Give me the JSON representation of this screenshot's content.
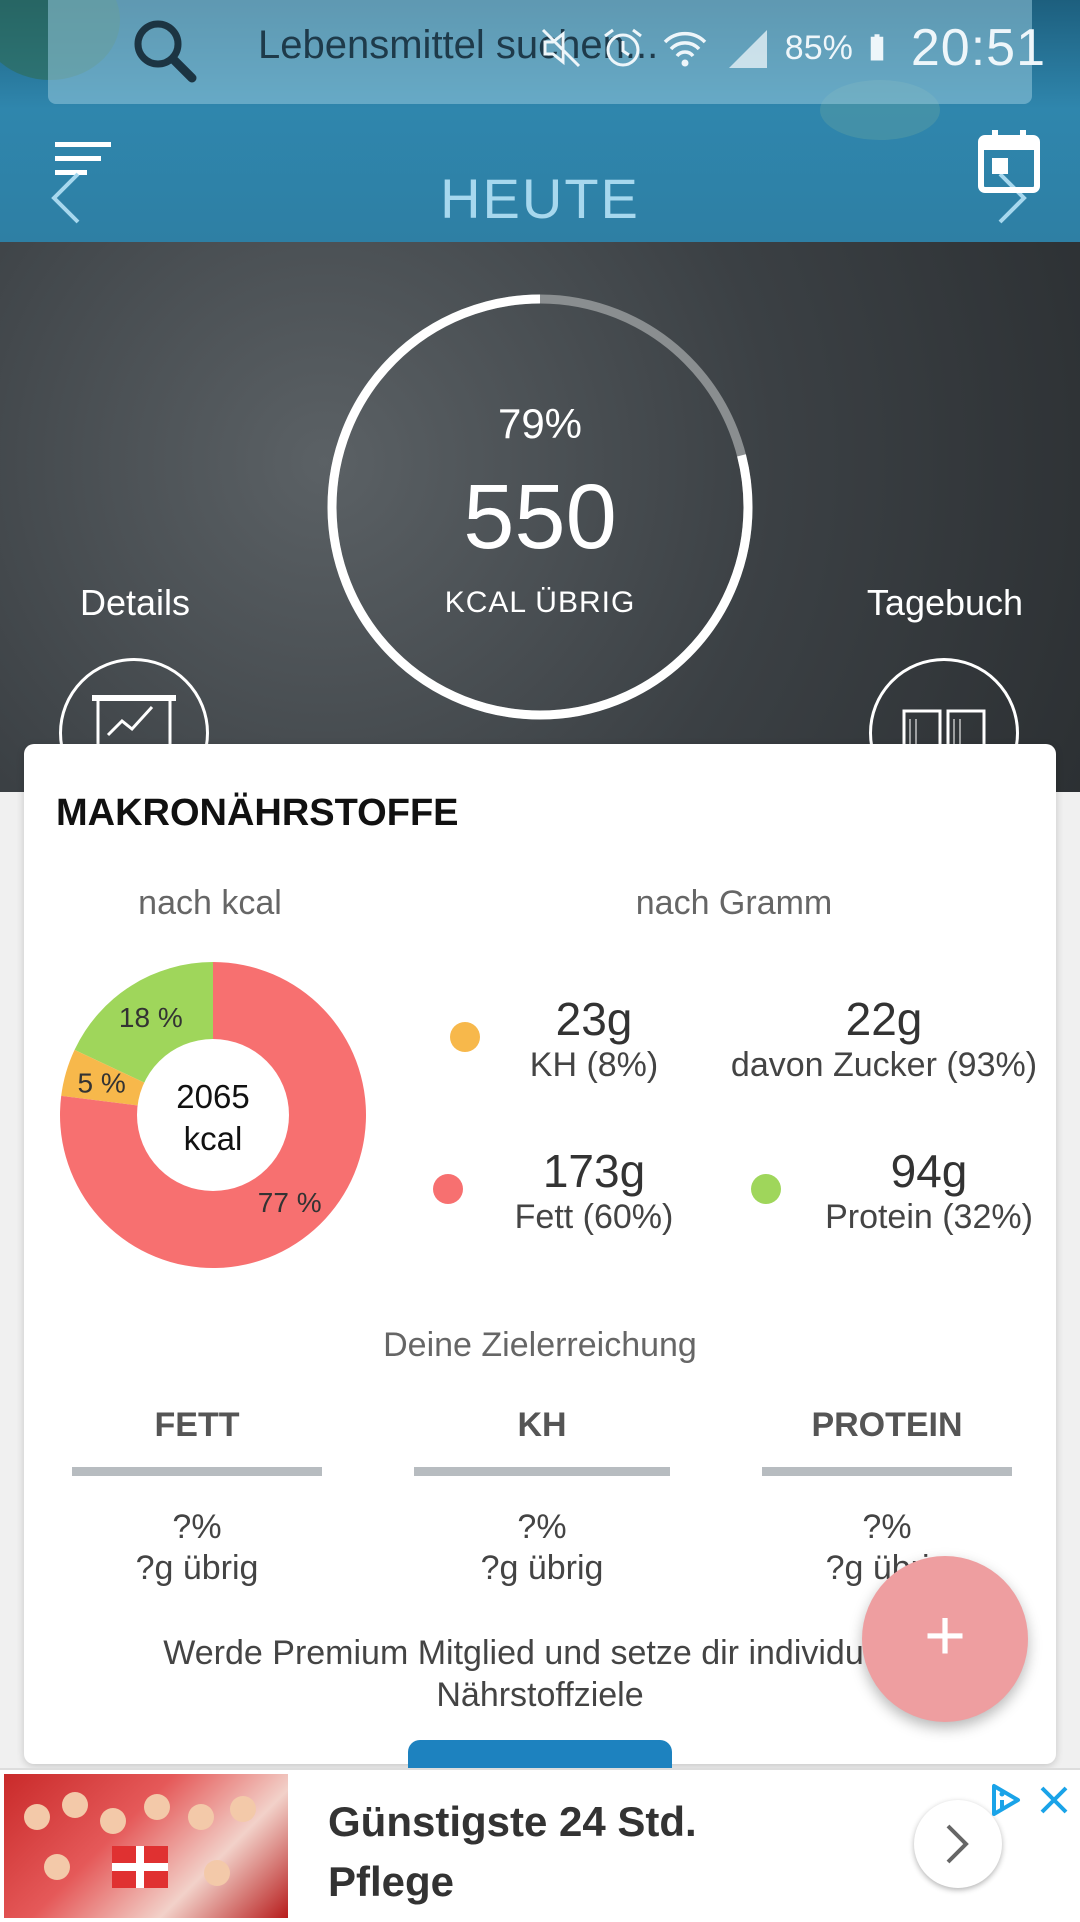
{
  "search": {
    "placeholder": "Lebensmittel suchen..."
  },
  "status_bar": {
    "battery": "85%",
    "time": "20:51"
  },
  "header": {
    "title": "HEUTE"
  },
  "summary": {
    "percent": "79%",
    "remaining_kcal": "550",
    "remaining_label": "KCAL ÜBRIG",
    "progress": 0.79,
    "details_label": "Details",
    "diary_label": "Tagebuch"
  },
  "macros": {
    "title": "MAKRONÄHRSTOFFE",
    "by_kcal_label": "nach kcal",
    "by_gram_label": "nach Gramm",
    "donut": {
      "total_value": "2065",
      "total_unit": "kcal",
      "slices": [
        {
          "name": "Protein",
          "percent": 18,
          "label": "18 %",
          "color": "#9fd65b"
        },
        {
          "name": "KH",
          "percent": 5,
          "label": "5 %",
          "color": "#f7b84b"
        },
        {
          "name": "Fett",
          "percent": 77,
          "label": "77 %",
          "color": "#f77070"
        }
      ]
    },
    "carbs": {
      "value": "23g",
      "label": "KH (8%)",
      "color": "#f7b84b"
    },
    "sugar": {
      "value": "22g",
      "label": "davon Zucker (93%)"
    },
    "fat": {
      "value": "173g",
      "label": "Fett (60%)",
      "color": "#f77070"
    },
    "protein": {
      "value": "94g",
      "label": "Protein (32%)",
      "color": "#9fd65b"
    }
  },
  "goals": {
    "title": "Deine Zielerreichung",
    "columns": [
      {
        "name": "FETT",
        "percent": "?%",
        "left": "?g übrig"
      },
      {
        "name": "KH",
        "percent": "?%",
        "left": "?g übrig"
      },
      {
        "name": "PROTEIN",
        "percent": "?%",
        "left": "?g übrig"
      }
    ],
    "premium_text": "Werde Premium Mitglied und setze dir individuelle Nährstoffziele"
  },
  "fab": {
    "label": "+"
  },
  "ad": {
    "text": "Günstigste 24 Std. Pflege"
  },
  "colors": {
    "accent": "#ee9ea0",
    "header": "#2f86ad",
    "button": "#1d82bf"
  }
}
